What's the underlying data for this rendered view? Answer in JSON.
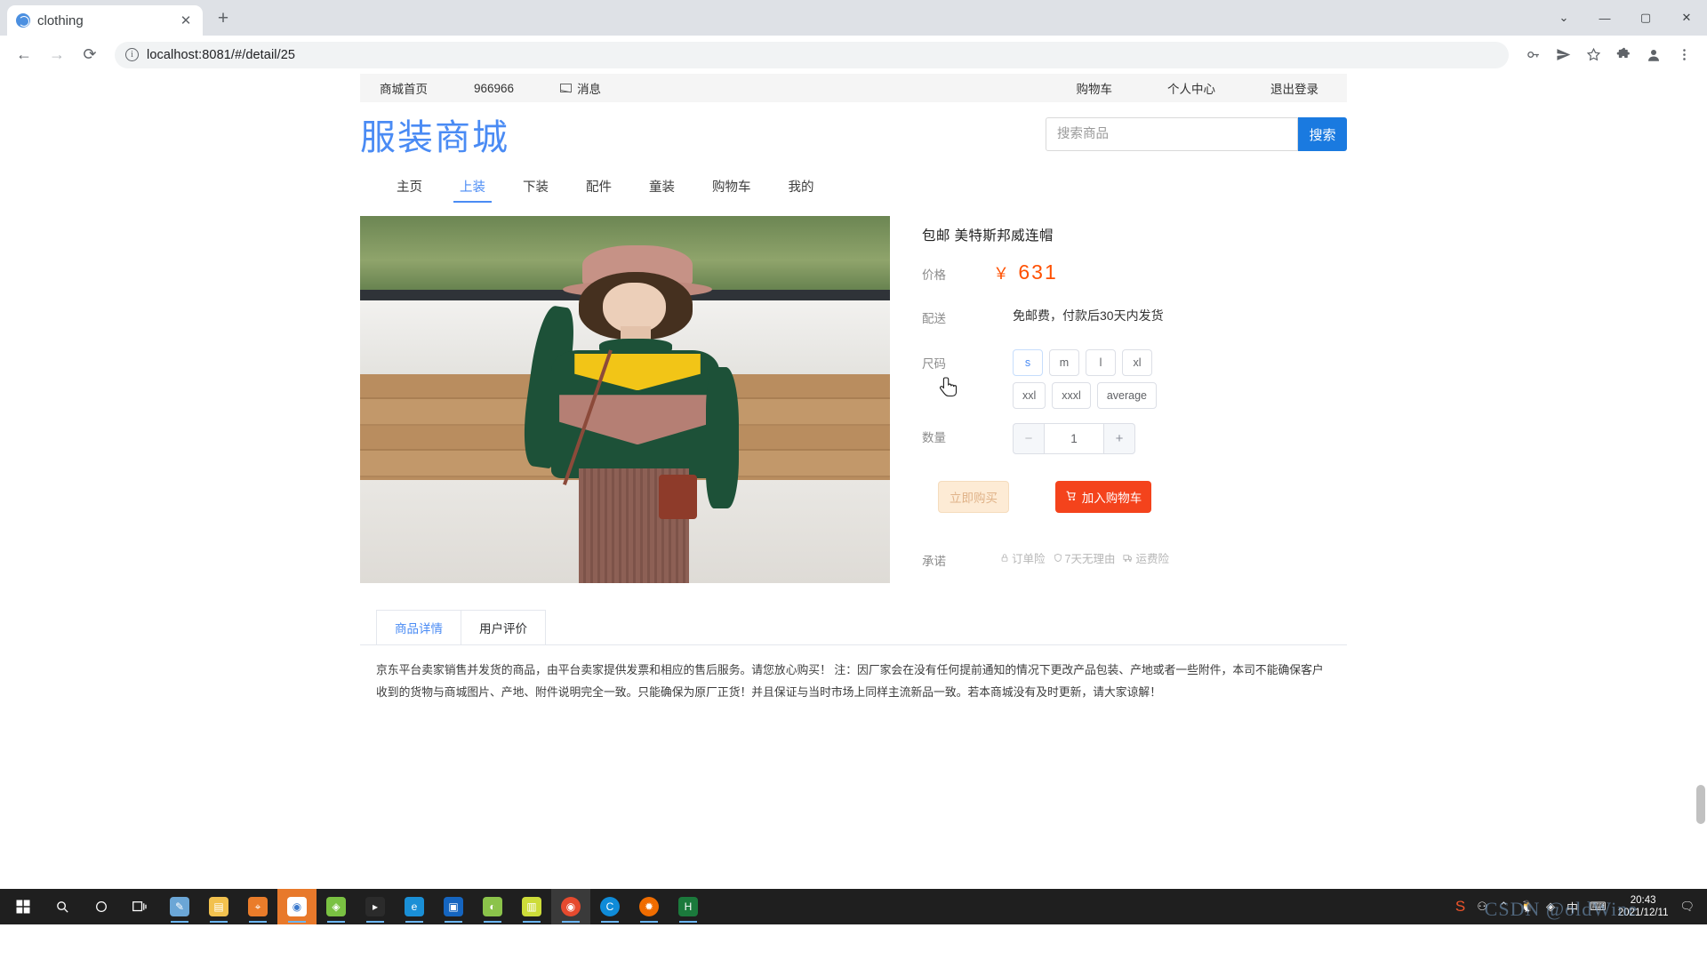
{
  "browser": {
    "tab": {
      "title": "clothing",
      "favicon": "globe-icon",
      "close": "✕"
    },
    "newtab_label": "+",
    "window_controls": {
      "minimize": "—",
      "maximize": "▢",
      "close": "✕",
      "chevron": "⌄"
    },
    "nav": {
      "back": "←",
      "forward": "→",
      "reload": "⟳"
    },
    "address": {
      "value": "localhost:8081/#/detail/25",
      "info_icon": "ⓘ"
    },
    "toolbar_icons": [
      "key-icon",
      "send-icon",
      "star-icon",
      "extensions-icon",
      "profile-icon",
      "menu-icon"
    ]
  },
  "topnav": {
    "left": [
      {
        "label": "商城首页"
      },
      {
        "label": "966966"
      },
      {
        "label": "消息",
        "icon": "envelope-icon"
      }
    ],
    "right": [
      {
        "label": "购物车"
      },
      {
        "label": "个人中心"
      },
      {
        "label": "退出登录"
      }
    ]
  },
  "header": {
    "logo": "服装商城",
    "logo_color": "#4a8bf4",
    "search": {
      "placeholder": "搜索商品",
      "value": "",
      "button": "搜索",
      "button_color": "#1a7ae0"
    }
  },
  "main_tabs": [
    {
      "label": "主页",
      "active": false
    },
    {
      "label": "上装",
      "active": true
    },
    {
      "label": "下装",
      "active": false
    },
    {
      "label": "配件",
      "active": false
    },
    {
      "label": "童装",
      "active": false
    },
    {
      "label": "购物车",
      "active": false
    },
    {
      "label": "我的",
      "active": false
    }
  ],
  "product": {
    "image_alt": "model wearing green yellow pink colorblock sweater with bucket hat",
    "title": "包邮  美特斯邦威连帽",
    "price": {
      "label": "价格",
      "currency": "￥",
      "amount": "631",
      "color": "#ff5000"
    },
    "shipping": {
      "label": "配送",
      "value": "免邮费，付款后30天内发货"
    },
    "size": {
      "label": "尺码",
      "options": [
        "s",
        "m",
        "l",
        "xl",
        "xxl",
        "xxxl",
        "average"
      ],
      "hovered": "s"
    },
    "quantity": {
      "label": "数量",
      "minus": "−",
      "value": "1",
      "plus": "+"
    },
    "actions": {
      "buy_now": "立即购买",
      "add_to_cart": "加入购物车",
      "cart_icon": "cart-icon"
    },
    "promise": {
      "label": "承诺",
      "items": [
        {
          "icon": "lock-icon",
          "text": "订单险"
        },
        {
          "icon": "shield-icon",
          "text": "7天无理由"
        },
        {
          "icon": "truck-icon",
          "text": "运费险"
        }
      ]
    }
  },
  "detail_tabs": [
    {
      "label": "商品详情",
      "active": true
    },
    {
      "label": "用户评价",
      "active": false
    }
  ],
  "description": "京东平台卖家销售并发货的商品，由平台卖家提供发票和相应的售后服务。请您放心购买！ 注：因厂家会在没有任何提前通知的情况下更改产品包装、产地或者一些附件，本司不能确保客户收到的货物与商城图片、产地、附件说明完全一致。只能确保为原厂正货！并且保证与当时市场上同样主流新品一致。若本商城没有及时更新，请大家谅解！",
  "taskbar": {
    "start": "start-icon",
    "items": [
      "search-icon",
      "cortana-icon",
      "taskview-icon",
      "notes-icon",
      "explorer-icon",
      "locate-icon",
      "idea-icon",
      "navicat-icon",
      "terminal-icon",
      "edge-legacy-icon",
      "vm-icon",
      "mint-icon",
      "wps-icon",
      "chrome-icon",
      "edge-icon",
      "firefox-icon",
      "hbuilder-icon"
    ],
    "tray": [
      "sogou-icon",
      "share-icon",
      "chevron-up-icon",
      "qq-icon",
      "wifi-icon",
      "ime-icon",
      "keyboard-icon",
      "action-center-icon"
    ],
    "time": "20:43",
    "date": "2021/12/11",
    "watermark": "CSDN @oldWine"
  }
}
